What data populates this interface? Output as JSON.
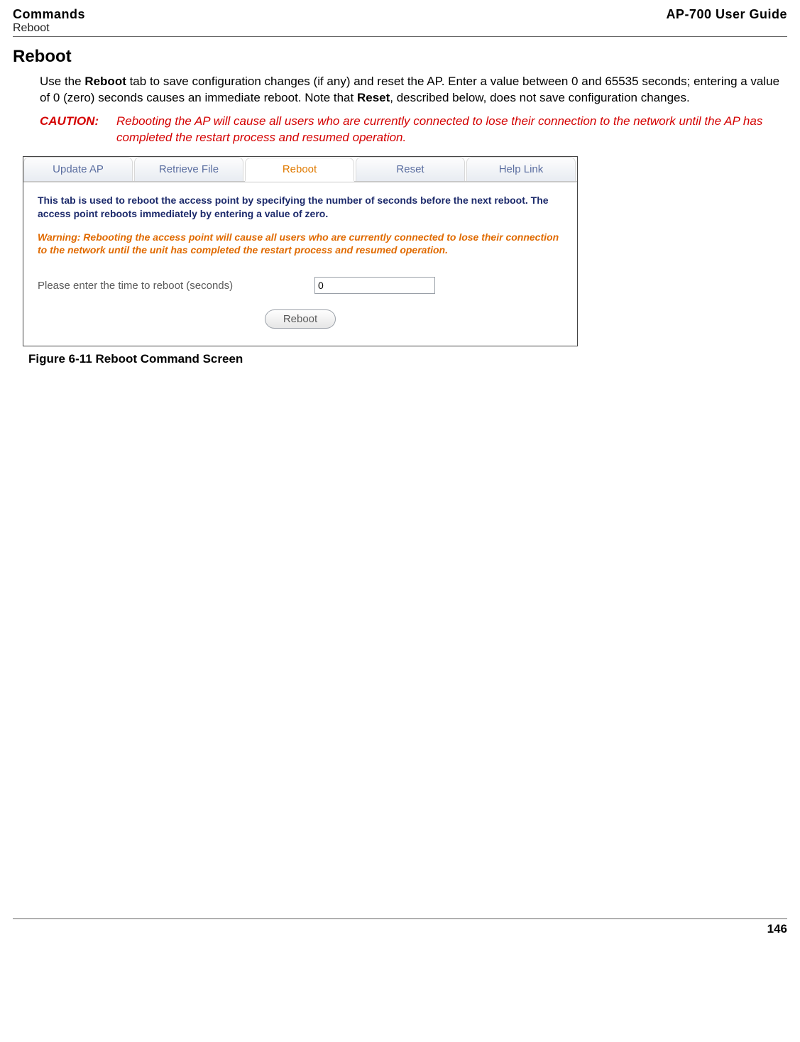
{
  "header": {
    "leftTop": "Commands",
    "leftBottom": "Reboot",
    "right": "AP-700 User Guide"
  },
  "section": {
    "title": "Reboot",
    "body_pre": "Use the ",
    "body_bold1": "Reboot",
    "body_mid": " tab to save configuration changes (if any) and reset the AP. Enter a value between 0 and 65535 seconds; entering a value of 0 (zero) seconds causes an immediate reboot. Note that ",
    "body_bold2": "Reset",
    "body_post": ", described below, does not save configuration changes.",
    "caution_label": "CAUTION:",
    "caution_text": "Rebooting the AP will cause all users who are currently connected to lose their connection to the network until the AP has completed the restart process and resumed operation."
  },
  "screenshot": {
    "tabs": [
      "Update AP",
      "Retrieve File",
      "Reboot",
      "Reset",
      "Help Link"
    ],
    "active_index": 2,
    "info": "This tab is used to reboot the access point by specifying the number of seconds before the next reboot. The access point reboots immediately by entering a value of zero.",
    "warn": "Warning: Rebooting the access point will cause all users who are currently connected to lose their connection to the network until the unit has completed the restart process and resumed operation.",
    "form_label": "Please enter the time to reboot (seconds)",
    "form_value": "0",
    "button": "Reboot"
  },
  "figure_caption": "Figure 6-11 Reboot Command Screen",
  "page_number": "146"
}
